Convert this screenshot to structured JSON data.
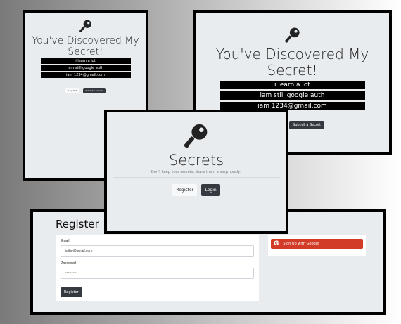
{
  "secrets_small": {
    "title": "You've Discovered My Secret!",
    "secrets": [
      "i learn a lot",
      "iam still google auth",
      "iam 1234@gmail.com"
    ],
    "logout_label": "Log Out",
    "submit_label": "Submit a Secret",
    "icon": "key-icon"
  },
  "secrets_large": {
    "title": "You've Discovered My Secret!",
    "secrets": [
      "i learn a lot",
      "iam still google auth",
      "iam 1234@gmail.com"
    ],
    "submit_label": "Submit a Secret",
    "icon": "key-icon"
  },
  "home": {
    "title": "Secrets",
    "tagline": "Don't keep your secrets, share them anonymously!",
    "register_label": "Register",
    "login_label": "Login",
    "icon": "key-icon"
  },
  "register": {
    "title": "Register",
    "email_label": "Email",
    "email_value": "jaiho@gmail.com",
    "password_label": "Password",
    "password_value": "•••••••••",
    "submit_label": "Register",
    "google_label": "Sign Up with Google",
    "google_icon": "google-icon"
  },
  "colors": {
    "panel_bg": "#e9ecef",
    "dark_button": "#343a40",
    "google_red": "#d13b27"
  }
}
